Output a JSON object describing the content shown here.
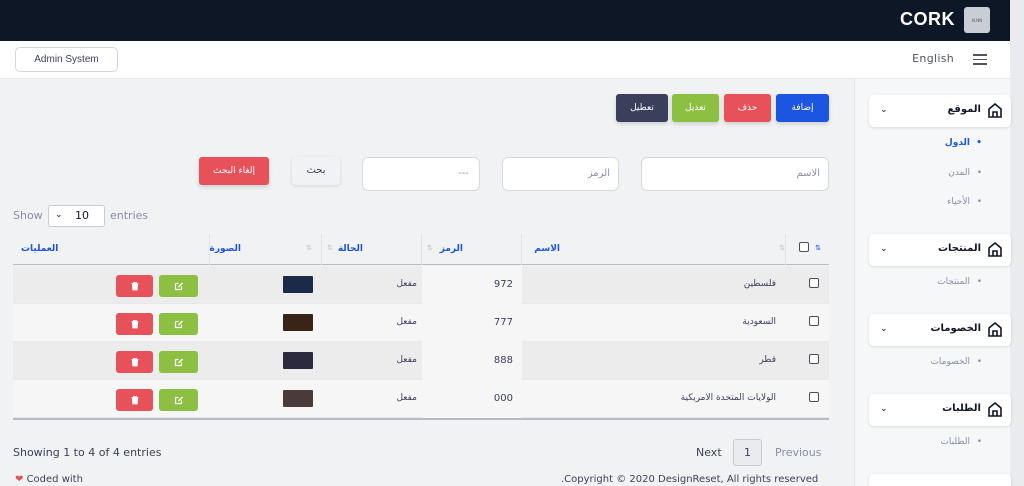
{
  "brand": {
    "name": "CORK",
    "logo_text": "N.NN"
  },
  "header": {
    "admin_label": "Admin System",
    "language": "English"
  },
  "sidebar": {
    "groups": [
      {
        "label": "الموقع",
        "items": [
          "الدول",
          "المدن",
          "الأحياء"
        ],
        "active": 0
      },
      {
        "label": "المنتجات",
        "items": [
          "المنتجات"
        ]
      },
      {
        "label": "الخصومات",
        "items": [
          "الخصومات"
        ]
      },
      {
        "label": "الطلبات",
        "items": [
          "الطلبات"
        ]
      }
    ]
  },
  "actions": {
    "add": "إضافة",
    "delete": "حذف",
    "edit": "تعديل",
    "disable": "تعطيل"
  },
  "filters": {
    "name_placeholder": "الاسم",
    "code_placeholder": "الرمز",
    "status_value": "---",
    "search": "بحث",
    "cancel_search": "إلغاء البحث"
  },
  "entries": {
    "show": "Show",
    "count": "10",
    "entries": "entries"
  },
  "table": {
    "headers": {
      "name": "الاسم",
      "code": "الرمز",
      "status": "الحالة",
      "image": "الصورة",
      "actions": "العمليات"
    },
    "rows": [
      {
        "name": "فلسطين",
        "code": "972",
        "status": "مفعل",
        "thumb_color": "#1c2a4a"
      },
      {
        "name": "السعودية",
        "code": "777",
        "status": "مفعل",
        "thumb_color": "#3a2418"
      },
      {
        "name": "قطر",
        "code": "888",
        "status": "مفعل",
        "thumb_color": "#2b2a3e"
      },
      {
        "name": "الولايات المتحدة الامريكية",
        "code": "000",
        "status": "مفعل",
        "thumb_color": "#4a3b3a"
      }
    ]
  },
  "footer": {
    "info": "Showing 1 to 4 of 4 entries",
    "previous": "Previous",
    "page": "1",
    "next": "Next",
    "coded_with": "Coded with",
    "copyright": ".Copyright © 2020 DesignReset, All rights reserved"
  },
  "colors": {
    "primary": "#1b55e2",
    "danger": "#e7515a",
    "success": "#8dbf42",
    "dark": "#3b3f5c",
    "navbar": "#0e1726"
  }
}
